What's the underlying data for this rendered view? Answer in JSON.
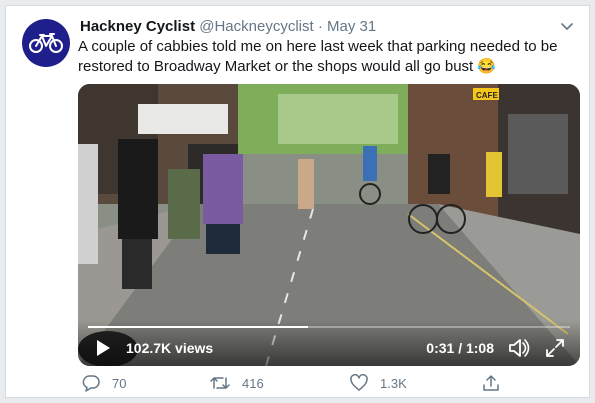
{
  "tweet": {
    "author_name": "Hackney Cyclist",
    "handle": "@Hackneycyclist",
    "separator": "·",
    "date": "May 31",
    "text": "A couple of cabbies told me on here last week that parking needed to be restored to Broadway Market or the shops would all go bust 😂"
  },
  "video": {
    "views": "102.7K views",
    "time": "0:31 / 1:08",
    "progress": 0.456,
    "scene_signs": {
      "cafe": "CAFE"
    }
  },
  "actions": {
    "replies": "70",
    "retweets": "416",
    "likes": "1.3K"
  },
  "colors": {
    "avatar_bg": "#1f1f8c",
    "text_secondary": "#657786"
  }
}
